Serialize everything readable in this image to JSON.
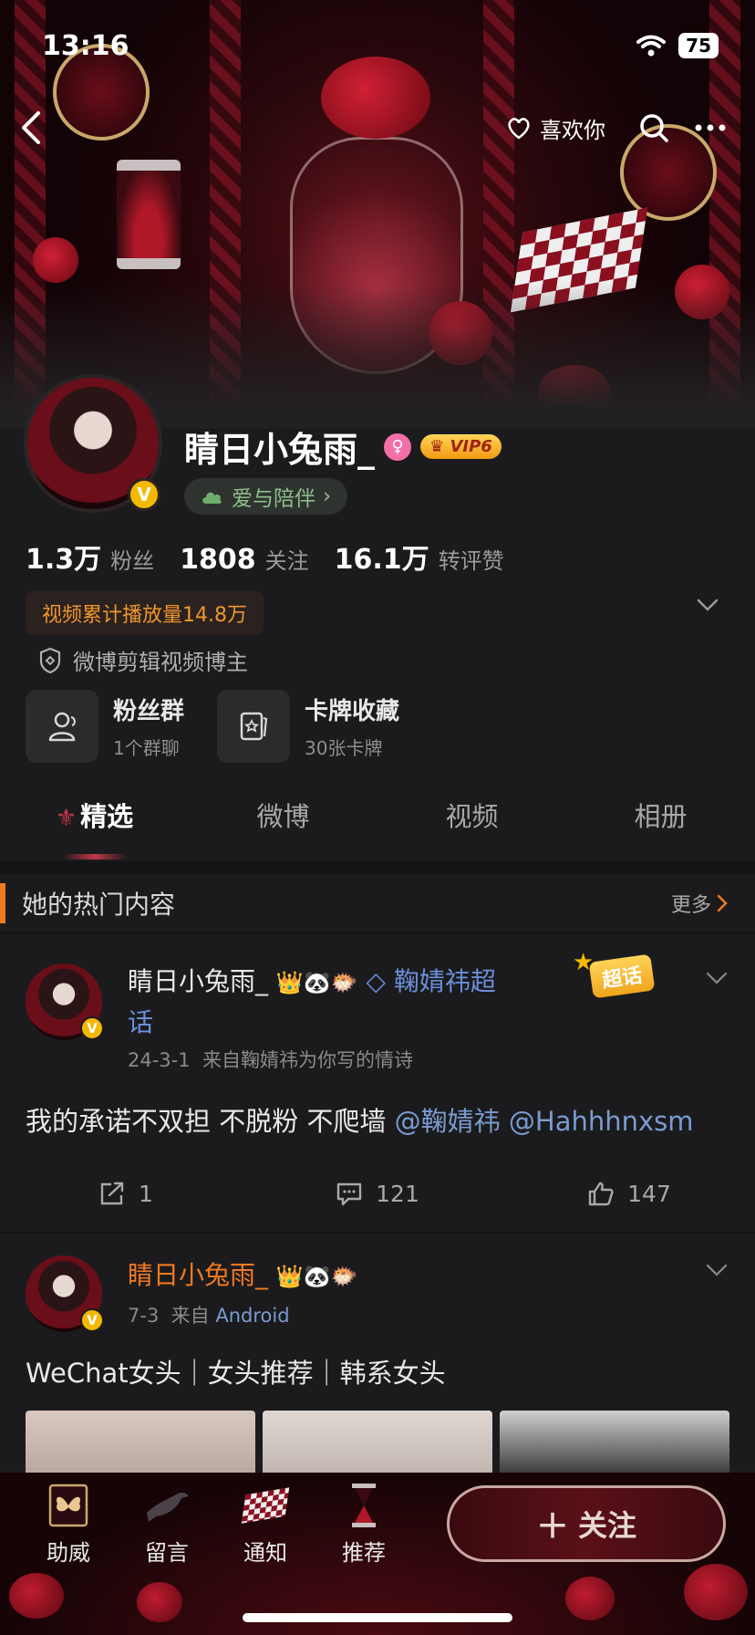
{
  "status_bar": {
    "time": "13:16",
    "battery": "75"
  },
  "header": {
    "like_label": "喜欢你"
  },
  "profile": {
    "username": "睛日小兔雨_",
    "vip_label": "VIP6",
    "love_label": "爱与陪伴",
    "verified_badge": "V",
    "stats": [
      {
        "value": "1.3万",
        "label": "粉丝"
      },
      {
        "value": "1808",
        "label": "关注"
      },
      {
        "value": "16.1万",
        "label": "转评赞"
      }
    ],
    "play_count": "视频累计播放量14.8万",
    "certification": "微博剪辑视频博主",
    "cards": [
      {
        "title": "粉丝群",
        "sub": "1个群聊"
      },
      {
        "title": "卡牌收藏",
        "sub": "30张卡牌"
      }
    ]
  },
  "tabs": [
    "精选",
    "微博",
    "视频",
    "相册"
  ],
  "hot": {
    "title": "她的热门内容",
    "more": "更多"
  },
  "posts": [
    {
      "name": "睛日小兔雨_",
      "super_topic": "鞠婧祎超",
      "super_topic_cont": "话",
      "super_badge": "超话",
      "date": "24-3-1",
      "source": "来自鞠婧祎为你写的情诗",
      "text": "我的承诺不双担 不脱粉 不爬墙 ",
      "mention1": "@鞠婧祎",
      "mention2": "@Hahhhnxsm",
      "reposts": "1",
      "comments": "121",
      "likes": "147"
    },
    {
      "name": "睛日小兔雨_",
      "date": "7-3",
      "source_prefix": "来自",
      "source": "Android",
      "text": "WeChat女头｜女头推荐｜韩系女头"
    }
  ],
  "bottom_nav": [
    {
      "label": "助威",
      "icon": "butterfly-icon"
    },
    {
      "label": "留言",
      "icon": "crow-icon"
    },
    {
      "label": "通知",
      "icon": "checkerboard-icon"
    },
    {
      "label": "推荐",
      "icon": "hourglass-icon"
    }
  ],
  "follow_button": "关注",
  "colors": {
    "accent_orange": "#f07a20",
    "vip_gold": "#f5b800",
    "mention_blue": "#7a9bd0",
    "theme_red": "#8a1020"
  }
}
